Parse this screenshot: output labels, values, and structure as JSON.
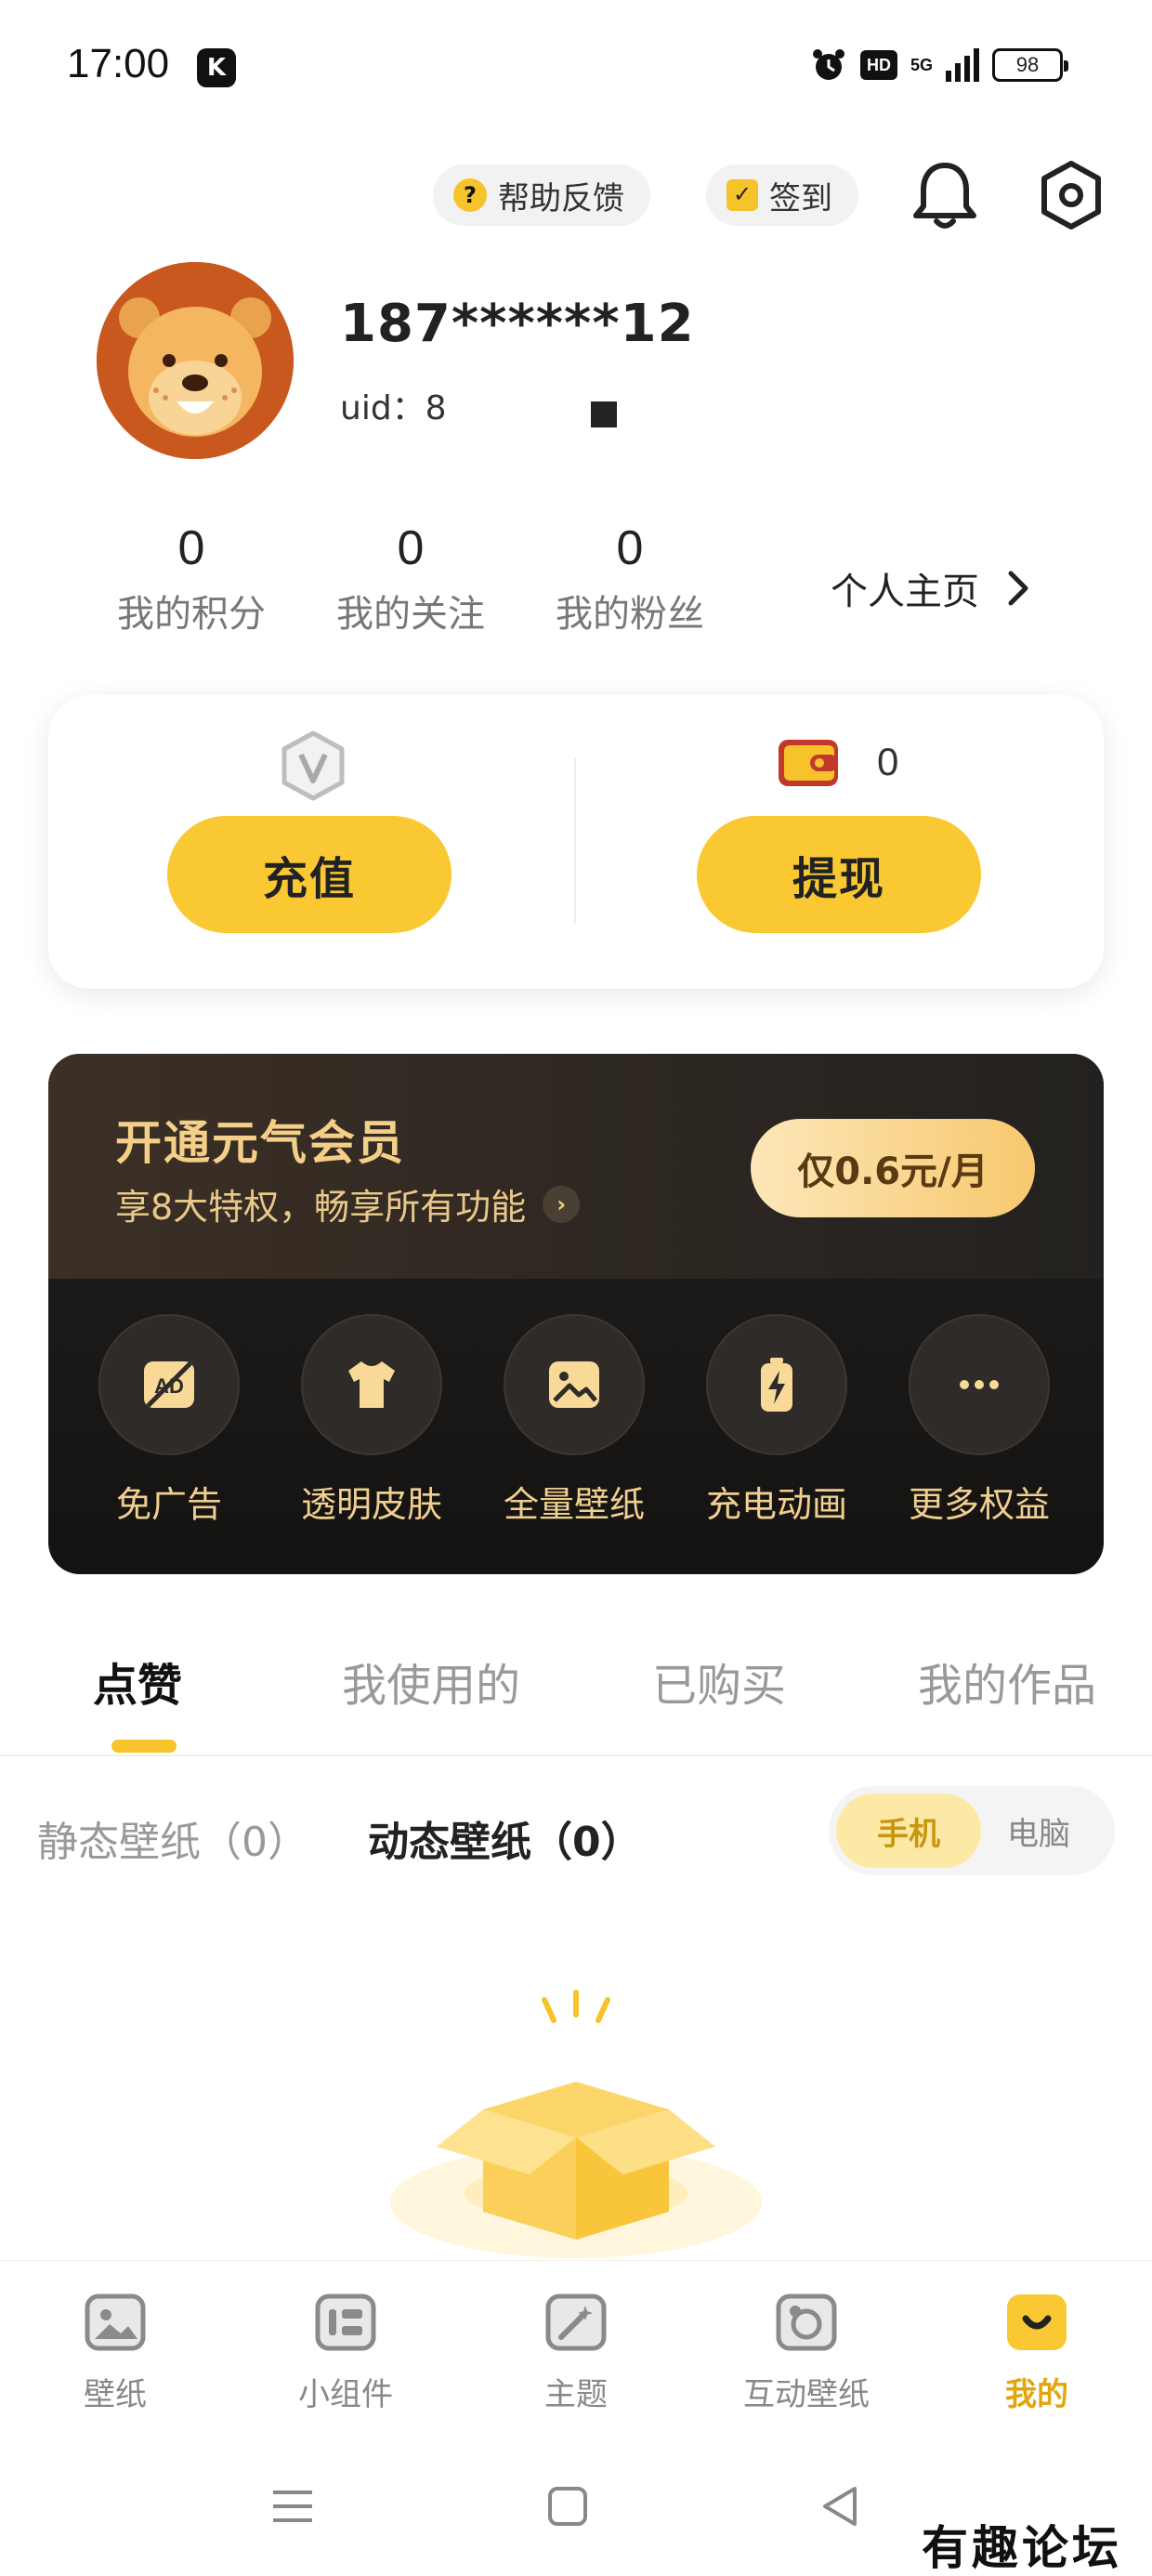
{
  "status_bar": {
    "time": "17:00",
    "app_badge": "K",
    "hd": "HD",
    "network": "5G",
    "battery": "98"
  },
  "header": {
    "help_label": "帮助反馈",
    "signin_label": "签到"
  },
  "profile": {
    "phone": "187******12",
    "uid": "uid：8"
  },
  "stats": [
    {
      "value": "0",
      "label": "我的积分"
    },
    {
      "value": "0",
      "label": "我的关注"
    },
    {
      "value": "0",
      "label": "我的粉丝"
    }
  ],
  "homepage_label": "个人主页",
  "wallet": {
    "balance": "0",
    "recharge_label": "充值",
    "withdraw_label": "提现"
  },
  "vip": {
    "title": "开通元气会员",
    "subtitle": "享8大特权，畅享所有功能",
    "price": "仅0.6元/月",
    "perks": [
      {
        "label": "免广告",
        "icon": "no-ads-icon"
      },
      {
        "label": "透明皮肤",
        "icon": "tshirt-icon"
      },
      {
        "label": "全量壁纸",
        "icon": "image-icon"
      },
      {
        "label": "充电动画",
        "icon": "battery-charge-icon"
      },
      {
        "label": "更多权益",
        "icon": "more-dots-icon"
      }
    ]
  },
  "tabs": [
    "点赞",
    "我使用的",
    "已购买",
    "我的作品"
  ],
  "subtabs": {
    "static": "静态壁纸（0）",
    "dynamic": "动态壁纸（0）"
  },
  "device_toggle": {
    "phone": "手机",
    "pc": "电脑"
  },
  "bottom_nav": [
    {
      "label": "壁纸",
      "icon": "wallpaper-icon"
    },
    {
      "label": "小组件",
      "icon": "widget-icon"
    },
    {
      "label": "主题",
      "icon": "theme-icon"
    },
    {
      "label": "互动壁纸",
      "icon": "interactive-wallpaper-icon"
    },
    {
      "label": "我的",
      "icon": "me-icon"
    }
  ],
  "watermark": "有趣论坛",
  "colors": {
    "accent": "#f9c832",
    "vip_gold": "#f4cf88",
    "active_nav": "#e2a60c"
  }
}
